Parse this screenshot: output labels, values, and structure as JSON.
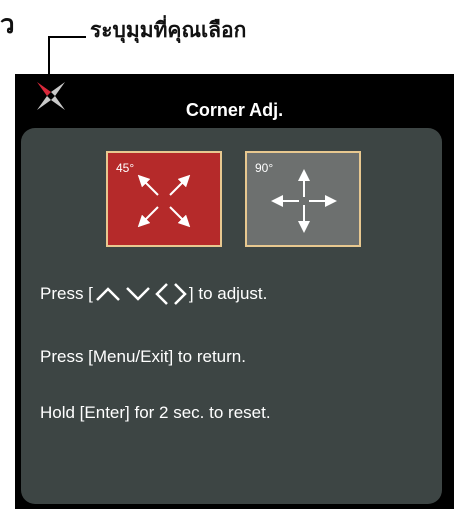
{
  "callout": {
    "clipped_char": "ว",
    "label": "ระบุมุมที่คุณเลือก"
  },
  "osd": {
    "title": "Corner Adj.",
    "modes": [
      {
        "label": "45°",
        "selected": true,
        "color": "#b52a2a"
      },
      {
        "label": "90°",
        "selected": false,
        "color": "#6d706f"
      }
    ],
    "instructions": {
      "adjust_prefix": "Press [",
      "adjust_suffix": "] to adjust.",
      "adjust_icons": [
        "up-icon",
        "down-icon",
        "left-icon",
        "right-icon"
      ],
      "menu_exit": "Press [Menu/Exit] to return.",
      "reset": "Hold [Enter] for 2 sec. to reset."
    }
  },
  "colors": {
    "panel": "#3d4544",
    "osd_background": "#000000",
    "selected_tile": "#b52a2a",
    "unselected_tile": "#6d706f",
    "tile_border": "#e8c890"
  }
}
